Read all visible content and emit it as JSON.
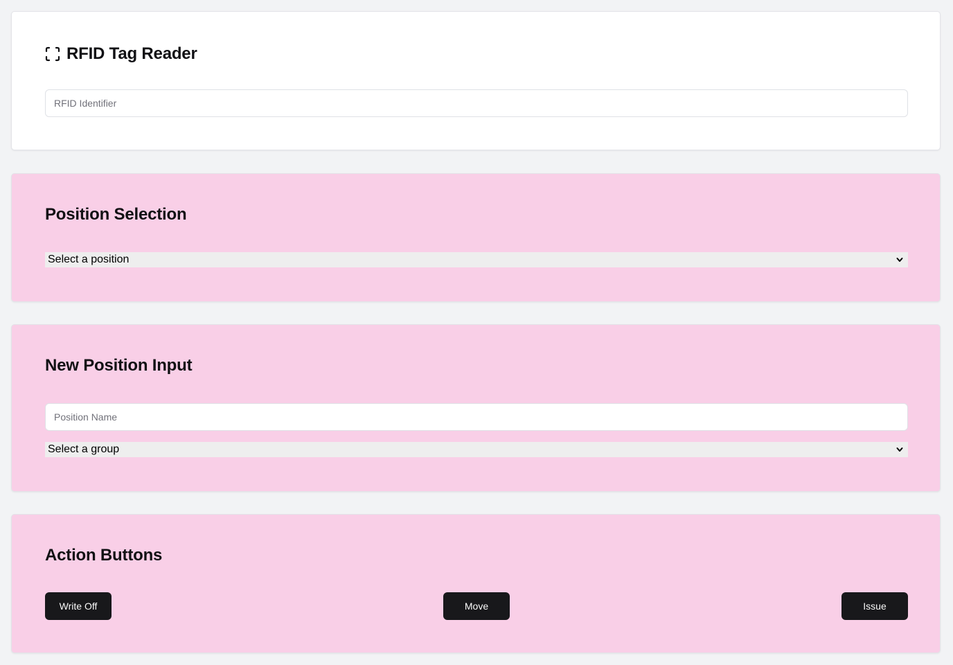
{
  "rfid_card": {
    "title": "RFID Tag Reader",
    "icon": "scan-icon",
    "input_placeholder": "RFID Identifier",
    "input_value": ""
  },
  "position_card": {
    "title": "Position Selection",
    "select_value": "Select a position"
  },
  "new_position_card": {
    "title": "New Position Input",
    "name_placeholder": "Position Name",
    "name_value": "",
    "group_select_value": "Select a group"
  },
  "actions_card": {
    "title": "Action Buttons",
    "write_off_label": "Write Off",
    "move_label": "Move",
    "issue_label": "Issue"
  },
  "colors": {
    "background": "#f2f3f5",
    "card_white": "#ffffff",
    "card_pink": "#f9cfe7",
    "button": "#18181b",
    "button_text": "#fafafa"
  }
}
